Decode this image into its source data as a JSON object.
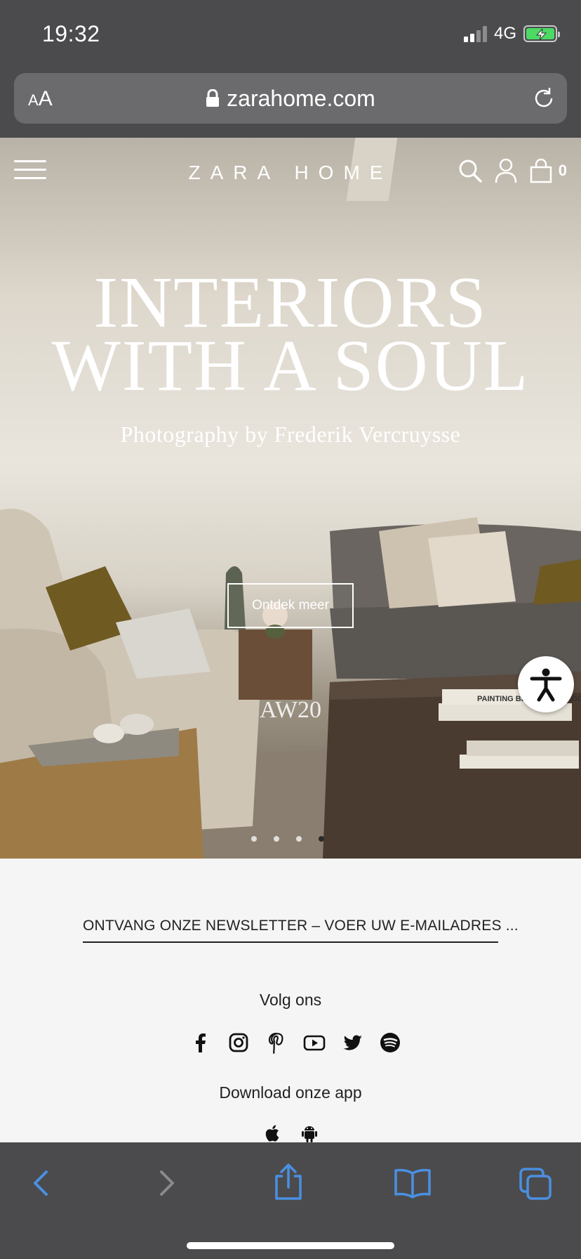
{
  "status_bar": {
    "time": "19:32",
    "network": "4G"
  },
  "browser": {
    "text_size_label_small": "A",
    "text_size_label_large": "A",
    "url": "zarahome.com"
  },
  "site_header": {
    "brand": "ZARA HOME",
    "cart_count": "0"
  },
  "hero": {
    "headline_line1": "INTERIORS",
    "headline_line2": "WITH A SOUL",
    "subtitle": "Photography by Frederik Vercruysse",
    "cta_label": "Ontdek meer",
    "season": "AW20",
    "slides_total": 4,
    "active_slide": 4,
    "book_title": "PAINTING BEYOND POLLOCK"
  },
  "footer": {
    "newsletter": "ONTVANG ONZE NEWSLETTER – VOER UW E-MAILADRES ...",
    "follow_label": "Volg ons",
    "socials": [
      "facebook-icon",
      "instagram-icon",
      "pinterest-icon",
      "youtube-icon",
      "twitter-icon",
      "spotify-icon"
    ],
    "download_label": "Download onze app",
    "stores": [
      "apple-icon",
      "android-icon"
    ]
  },
  "colors": {
    "chrome": "#4b4b4d",
    "url_bar": "#6b6b6d",
    "safari_blue": "#4a90e2",
    "battery_green": "#4cd964",
    "footer_bg": "#f5f5f5"
  }
}
